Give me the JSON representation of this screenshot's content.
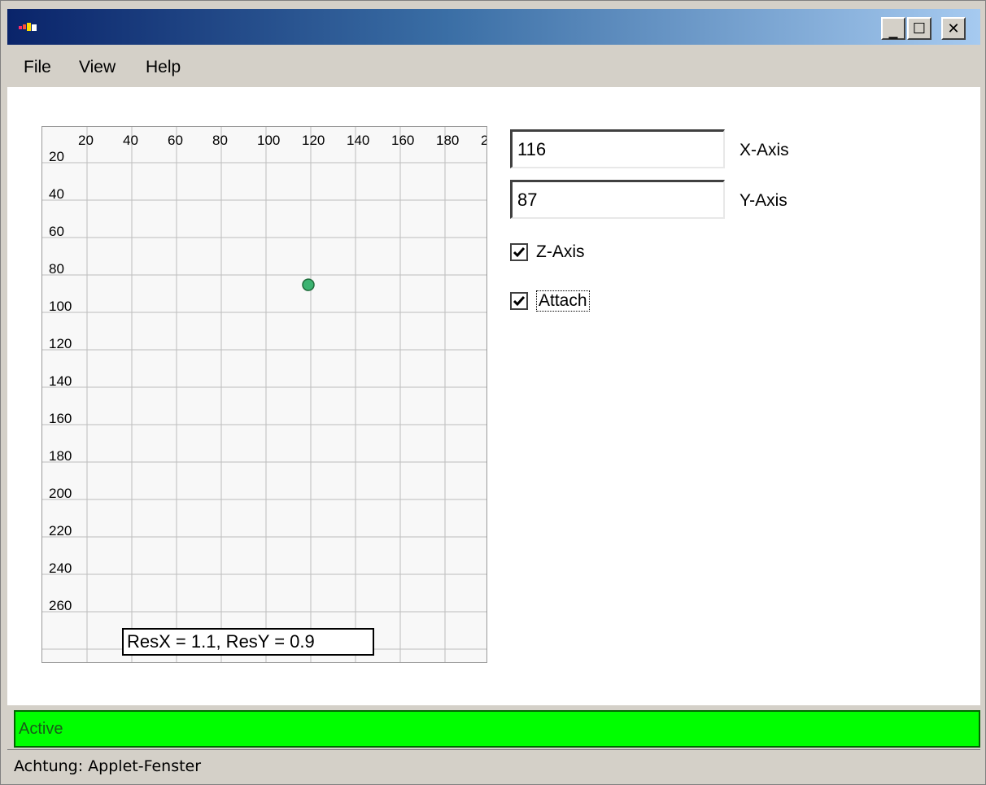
{
  "window": {
    "controls": {
      "minimize": "_",
      "maximize": "☐",
      "close": "✕"
    }
  },
  "menu": {
    "file": "File",
    "view": "View",
    "help": "Help"
  },
  "plot": {
    "x_ticks": [
      "20",
      "40",
      "60",
      "80",
      "100",
      "120",
      "140",
      "160",
      "180",
      "2"
    ],
    "y_ticks": [
      "20",
      "40",
      "60",
      "80",
      "100",
      "120",
      "140",
      "160",
      "180",
      "200",
      "220",
      "240",
      "260"
    ],
    "point": {
      "x": 116,
      "y": 87,
      "color": "#3cb371"
    },
    "resolution_text": "ResX = 1.1, ResY = 0.9"
  },
  "controls": {
    "x_value": "116",
    "x_label": "X-Axis",
    "y_value": "87",
    "y_label": "Y-Axis",
    "z_label": "Z-Axis",
    "z_checked": true,
    "attach_label": "Attach",
    "attach_checked": true
  },
  "status": {
    "text": "Active",
    "color": "#00ff00"
  },
  "footer": {
    "warning": "Achtung: Applet-Fenster"
  }
}
